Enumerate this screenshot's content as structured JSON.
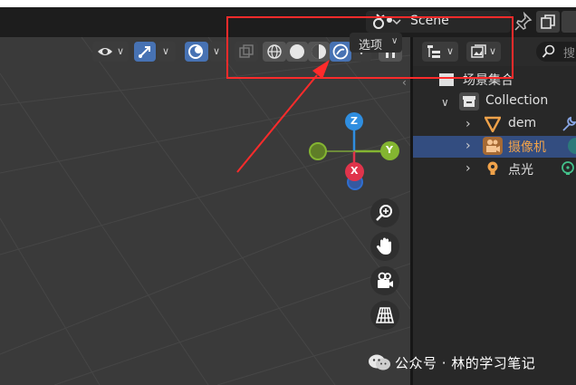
{
  "scene": {
    "name": "Scene",
    "icon": "scene-icon",
    "pin_icon": "pin-icon",
    "new_icon": "new-scene-icon"
  },
  "viewport": {
    "options_label": "选项",
    "header_icons": [
      "view-eye-icon",
      "gizmo-arrow-icon",
      "overlay-circle-icon",
      "xray-toggle-icon",
      "wireframe-shading-icon",
      "solid-shading-icon",
      "material-preview-icon",
      "rendered-shading-icon",
      "pause-icon"
    ],
    "gizmo": {
      "z_label": "Z",
      "y_label": "Y",
      "x_label": "X",
      "colors": {
        "x": "#e0344b",
        "y": "#84b531",
        "z": "#2f8ee0"
      }
    },
    "nav_icons": [
      "zoom-icon",
      "pan-hand-icon",
      "camera-view-icon",
      "perspective-grid-icon"
    ]
  },
  "outliner": {
    "header_icons": [
      "display-mode-icon",
      "filter-icon",
      "search-icon"
    ],
    "search_placeholder": "搜",
    "scene_collection": "场景集合",
    "collection": "Collection",
    "items": [
      {
        "label": "dem",
        "icon": "mesh-triangle-icon",
        "extra": "modifier-wrench-icon",
        "selected": false
      },
      {
        "label": "摄像机",
        "icon": "camera-object-icon",
        "extra": "camera-data-icon",
        "selected": true
      },
      {
        "label": "点光",
        "icon": "light-bulb-icon",
        "extra": "light-data-icon",
        "selected": false
      }
    ]
  },
  "colors": {
    "accent_blue": "#4772b3",
    "selection": "#334d80",
    "annotation_red": "#ff2b2b",
    "camera_orange": "#e8a35a"
  },
  "watermark": {
    "text": "公众号 · 林的学习笔记"
  }
}
